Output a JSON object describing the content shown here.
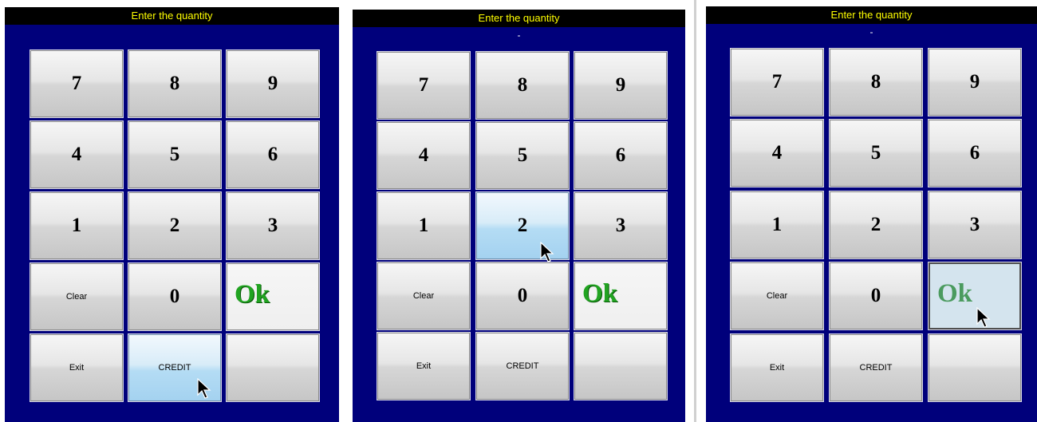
{
  "title": "Enter the quantity",
  "panels": [
    {
      "display_value": "",
      "keys": [
        "7",
        "8",
        "9",
        "4",
        "5",
        "6",
        "1",
        "2",
        "3",
        "Clear",
        "0",
        "Ok",
        "Exit",
        "CREDIT",
        ""
      ],
      "hover_key": "CREDIT",
      "cursor": "arrow-pointer-icon"
    },
    {
      "display_value": "-",
      "keys": [
        "7",
        "8",
        "9",
        "4",
        "5",
        "6",
        "1",
        "2",
        "3",
        "Clear",
        "0",
        "Ok",
        "Exit",
        "CREDIT",
        ""
      ],
      "hover_key": "2",
      "cursor": "arrow-pointer-icon"
    },
    {
      "display_value": "-",
      "keys": [
        "7",
        "8",
        "9",
        "4",
        "5",
        "6",
        "1",
        "2",
        "3",
        "Clear",
        "0",
        "Ok",
        "Exit",
        "CREDIT",
        ""
      ],
      "pressed_key": "Ok",
      "cursor": "arrow-pointer-icon"
    }
  ],
  "colors": {
    "panel_bg": "#00007b",
    "title_bar": "#000000",
    "title_text": "#ffff00",
    "ok_text": "#21a321",
    "hover_key": "#b4dcf4"
  }
}
